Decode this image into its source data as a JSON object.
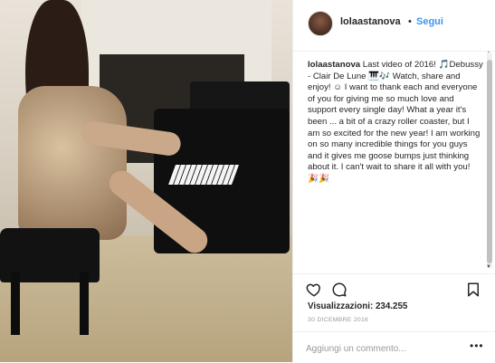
{
  "post": {
    "username": "lolaastanova",
    "separator": "•",
    "follow_label": "Segui",
    "caption_user": "lolaastanova",
    "caption_text": "Last video of 2016! 🎵Debussy - Clair De Lune 🎹🎶 Watch, share and enjoy! ☺ I want to thank each and everyone of you for giving me so much love and support every single day! What a year it's been ... a bit of a crazy roller coaster, but I am so excited for the new year! I am working on so many incredible things for you guys and it gives me goose bumps just thinking about it. I can't wait to share it all with you! 🎉🎉",
    "views": "Visualizzazioni: 234.255",
    "date": "30 DICEMBRE 2016",
    "comment_placeholder": "Aggiungi un commento...",
    "more_label": "•••"
  },
  "icons": {
    "like": "heart-icon",
    "comment": "comment-icon",
    "save": "bookmark-icon"
  },
  "colors": {
    "accent": "#3897f0",
    "text": "#262626",
    "muted": "#999999"
  }
}
